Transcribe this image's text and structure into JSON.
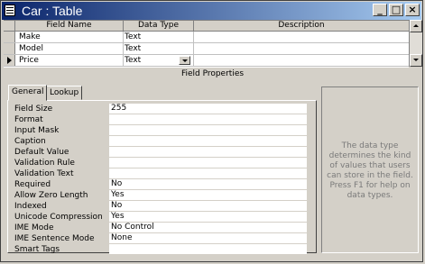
{
  "window": {
    "title": "Car : Table",
    "buttons": {
      "minimize": "_",
      "maximize": "□",
      "close": "×"
    }
  },
  "grid": {
    "headers": [
      "Field Name",
      "Data Type",
      "Description"
    ],
    "rows": [
      {
        "field": "Make",
        "type": "Text"
      },
      {
        "field": "Model",
        "type": "Text"
      },
      {
        "field": "Price",
        "type": "Text"
      }
    ]
  },
  "field_properties": {
    "title": "Field Properties",
    "tabs": [
      "General",
      "Lookup"
    ],
    "properties": [
      {
        "label": "Field Size",
        "value": "255"
      },
      {
        "label": "Format",
        "value": ""
      },
      {
        "label": "Input Mask",
        "value": ""
      },
      {
        "label": "Caption",
        "value": ""
      },
      {
        "label": "Default Value",
        "value": ""
      },
      {
        "label": "Validation Rule",
        "value": ""
      },
      {
        "label": "Validation Text",
        "value": ""
      },
      {
        "label": "Required",
        "value": "No"
      },
      {
        "label": "Allow Zero Length",
        "value": "Yes"
      },
      {
        "label": "Indexed",
        "value": "No"
      },
      {
        "label": "Unicode Compression",
        "value": "Yes"
      },
      {
        "label": "IME Mode",
        "value": "No Control"
      },
      {
        "label": "IME Sentence Mode",
        "value": "None"
      },
      {
        "label": "Smart Tags",
        "value": ""
      }
    ],
    "help_text": "The data type determines the kind of values that users can store in the field. Press F1 for help on data types."
  },
  "colors": {
    "title_start": "#0a246a",
    "title_end": "#a6caf0",
    "face": "#d4d0c8",
    "help_text": "#7a7a7a"
  }
}
